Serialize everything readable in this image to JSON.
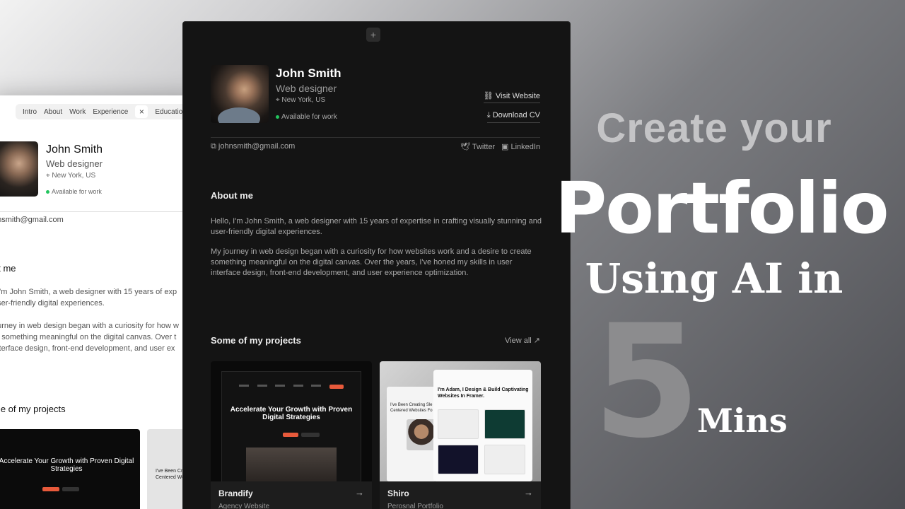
{
  "left_mock": {
    "nav": [
      "Intro",
      "About",
      "Work",
      "Experience"
    ],
    "nav_close": "×",
    "nav_partial": "Educatio",
    "name": "John Smith",
    "role": "Web designer",
    "location": "New York, US",
    "availability": "Available for work",
    "email": "hnsmith@gmail.com",
    "about_heading": "ut me",
    "about_lines": [
      ", I'm John Smith, a web designer with 15 years of exp",
      "user-friendly digital experiences.",
      "ourney in web design began with a curiosity for how w",
      "te something meaningful on the digital canvas. Over t",
      " interface design, front-end development, and user ex"
    ],
    "projects_heading": "me of my projects",
    "card1_headline": "Accelerate Your Growth with Proven Digital Strategies",
    "card2_text": "I've Been Cre Centered We"
  },
  "profile": {
    "add_button": "+",
    "name": "John Smith",
    "role": "Web designer",
    "location": "New York, US",
    "availability": "Available for work",
    "visit_website": "Visit Website",
    "download_cv": "Download CV",
    "email": "johnsmith@gmail.com",
    "twitter": "Twitter",
    "linkedin": "LinkedIn"
  },
  "about": {
    "heading": "About me",
    "p1": "Hello, I'm John Smith, a web designer with 15 years of expertise in crafting visually stunning and user-friendly digital experiences.",
    "p2": "My journey in web design began with a curiosity for how websites work and a desire to create something meaningful on the digital canvas. Over the years, I've honed my skills in user interface design, front-end development, and user experience optimization."
  },
  "projects": {
    "heading": "Some of my projects",
    "view_all": "View all ↗",
    "items": [
      {
        "title": "Brandify",
        "subtitle": "Agency Website",
        "headline": "Accelerate Your Growth with Proven Digital Strategies"
      },
      {
        "title": "Shiro",
        "subtitle": "Perosnal Portfolio",
        "headline": "I'm Adam, I Design & Build Captivating Websites In Framer.",
        "side_text": "I've Been Creating Sle Centered Websites Fo"
      }
    ]
  },
  "hero": {
    "line1": "Create your",
    "line2": "Portfolio",
    "line3": "Using AI in",
    "number": "5",
    "unit": "Mins"
  }
}
